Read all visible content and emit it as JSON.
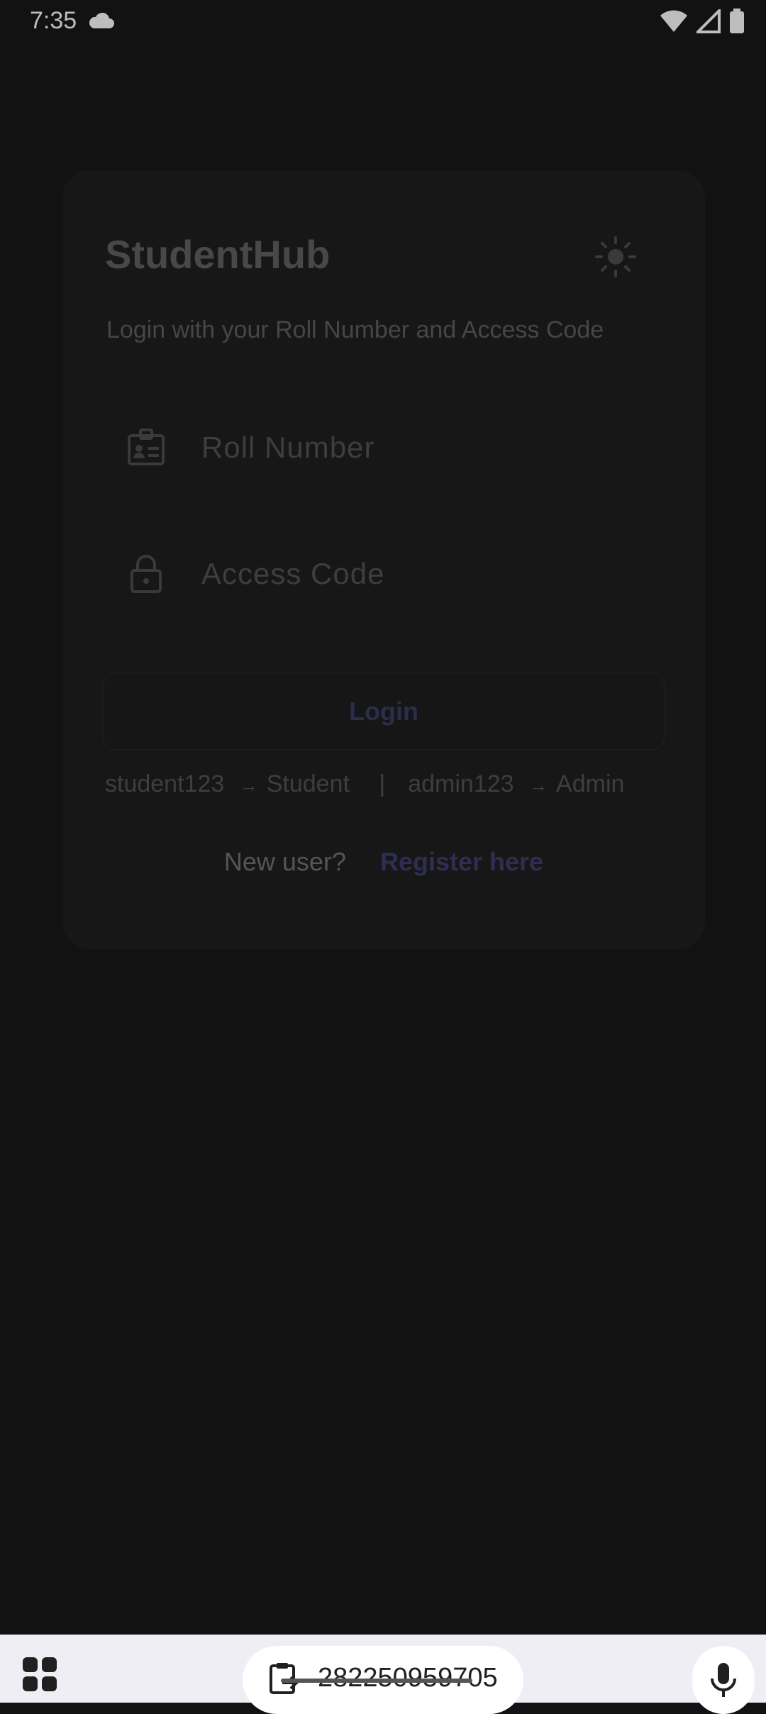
{
  "status_bar": {
    "time": "7:35",
    "icons": [
      "cloud-icon",
      "wifi-icon",
      "signal-icon",
      "battery-icon"
    ]
  },
  "login_card": {
    "title": "StudentHub",
    "theme_icon": "sun-icon",
    "subtitle": "Login with your Roll Number and Access Code",
    "roll_number": {
      "placeholder": "Roll Number",
      "value": "",
      "icon": "id-badge-icon"
    },
    "access_code": {
      "placeholder": "Access Code",
      "value": "",
      "icon": "lock-icon"
    },
    "login_label": "Login",
    "hint": {
      "student_code": "student123",
      "arrow1": "→",
      "student_role": "Student",
      "separator": "|",
      "admin_code": "admin123",
      "arrow2": "→",
      "admin_role": "Admin"
    },
    "new_user_text": "New user?",
    "register_link": "Register here"
  },
  "keyboard_bar": {
    "clipboard_text": "282250959705",
    "icons": [
      "apps-grid-icon",
      "clipboard-icon",
      "mic-icon"
    ]
  },
  "colors": {
    "background": "#121212",
    "card": "#171717",
    "accent": "#2e2e52",
    "keyboard_bar": "#eeeef4"
  }
}
